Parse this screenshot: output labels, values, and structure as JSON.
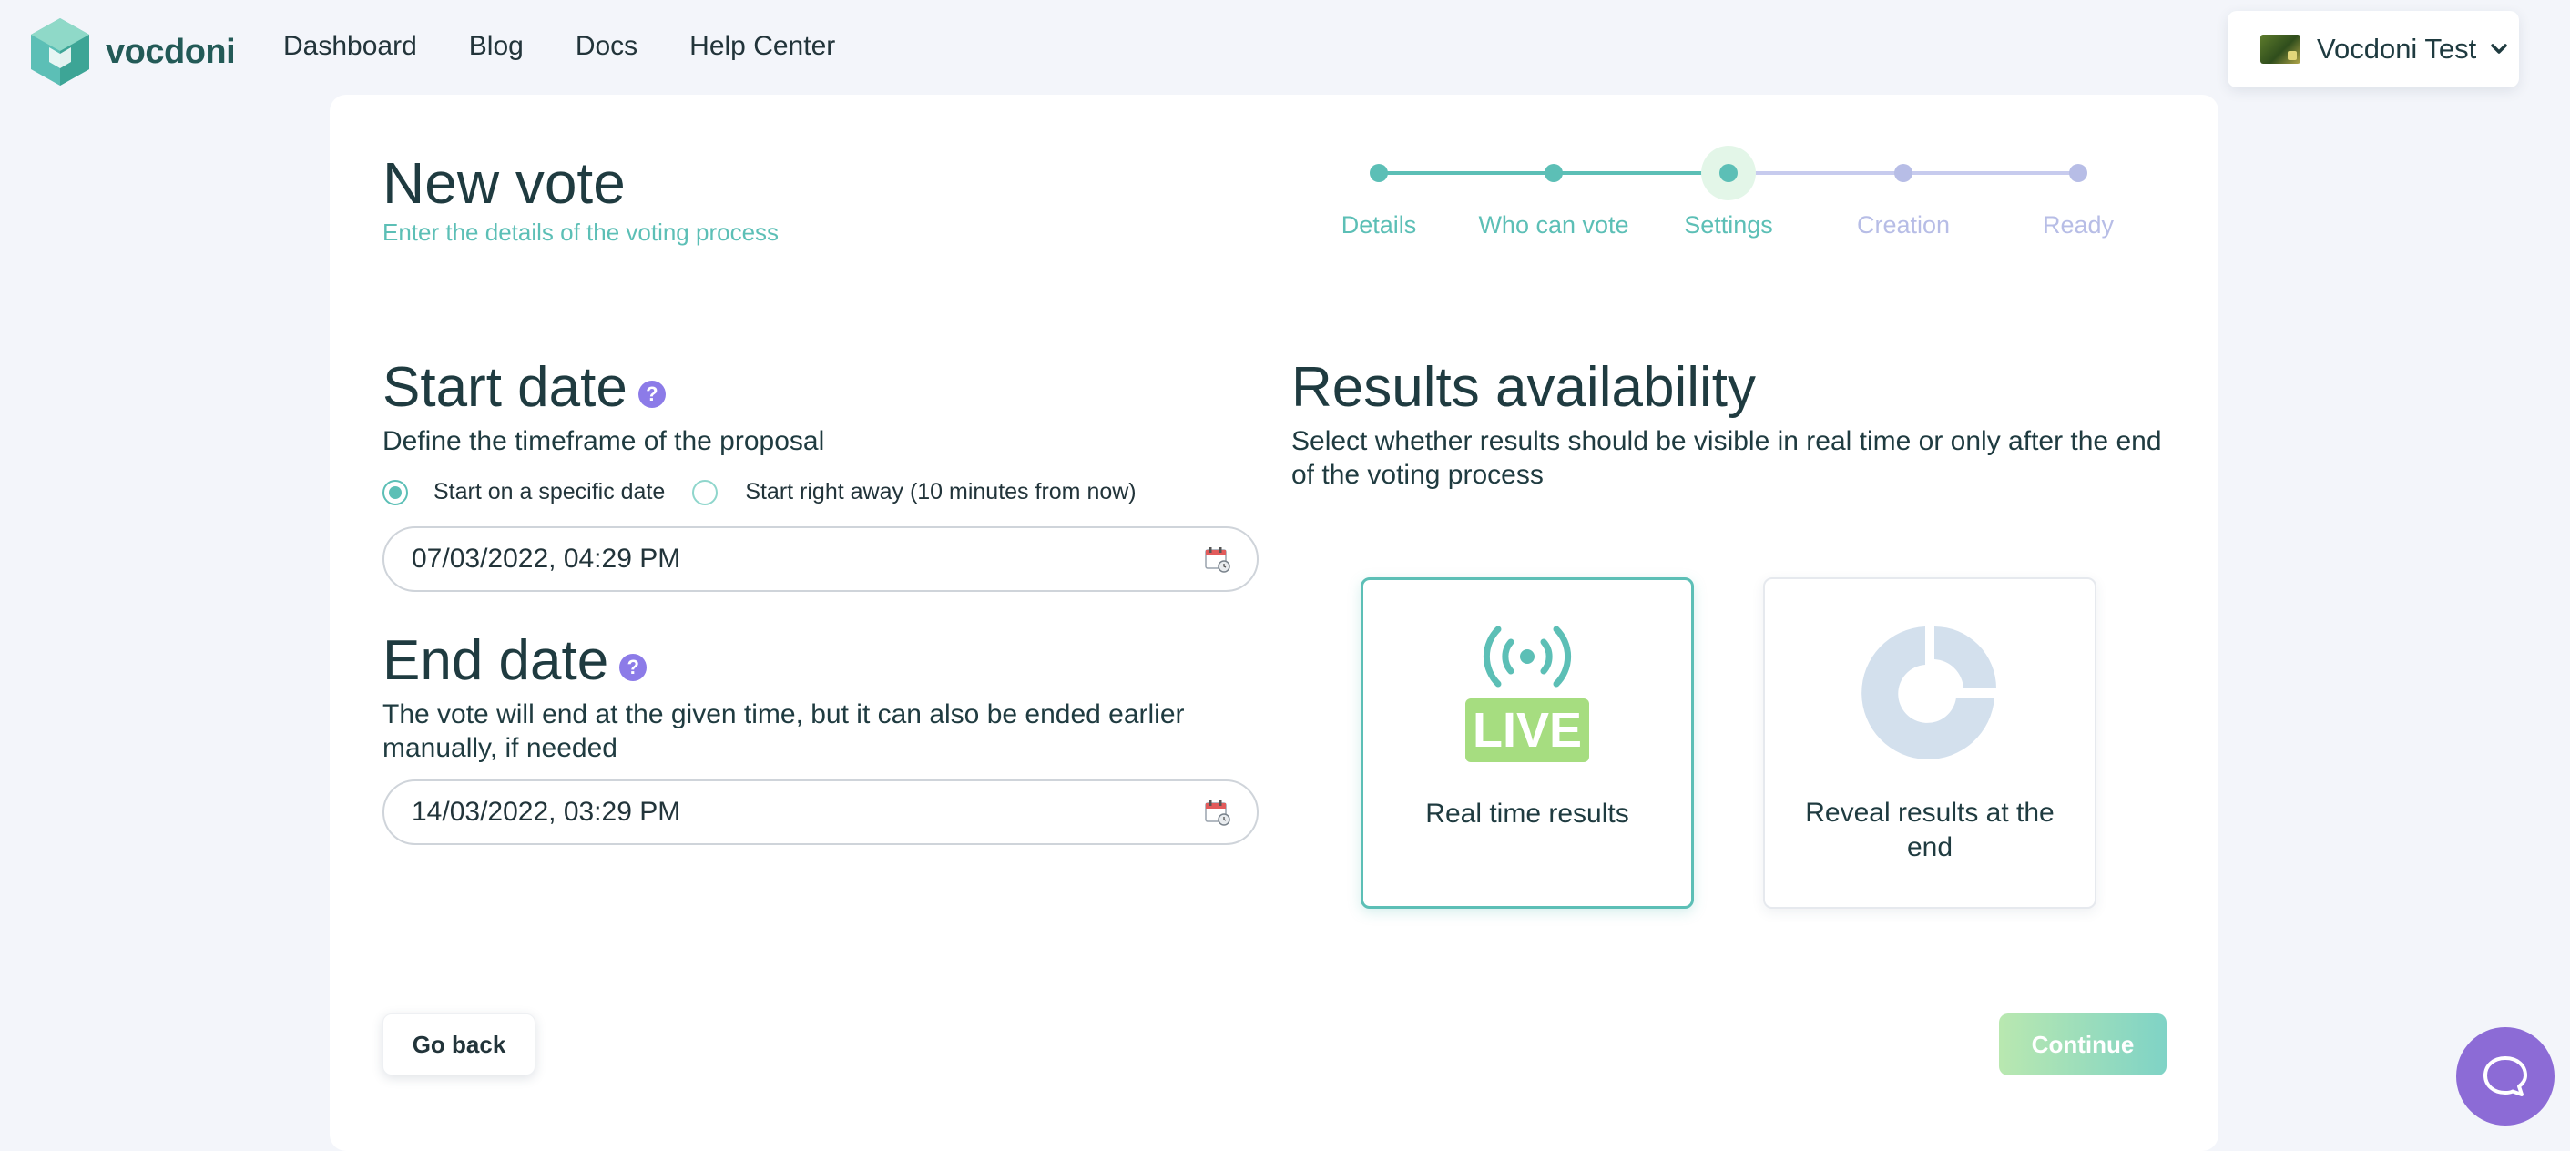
{
  "header": {
    "logo_text": "vocdoni",
    "nav": [
      "Dashboard",
      "Blog",
      "Docs",
      "Help Center"
    ],
    "account_name": "Vocdoni Test"
  },
  "page": {
    "title": "New vote",
    "subtitle": "Enter the details of the voting process"
  },
  "stepper": {
    "steps": [
      {
        "label": "Details",
        "state": "done"
      },
      {
        "label": "Who can vote",
        "state": "done"
      },
      {
        "label": "Settings",
        "state": "current"
      },
      {
        "label": "Creation",
        "state": "pending"
      },
      {
        "label": "Ready",
        "state": "pending"
      }
    ]
  },
  "start": {
    "title": "Start date",
    "help": "?",
    "description": "Define the timeframe of the proposal",
    "radio_specific": "Start on a specific date",
    "radio_now": "Start right away (10 minutes from now)",
    "value": "07/03/2022, 04:29 PM"
  },
  "end": {
    "title": "End date",
    "help": "?",
    "description": "The vote will end at the given time, but it can also be ended earlier manually, if needed",
    "value": "14/03/2022, 03:29 PM"
  },
  "results": {
    "title": "Results availability",
    "description": "Select whether results should be visible in real time or only after the end of the voting process",
    "live_badge": "LIVE",
    "option_realtime": "Real time results",
    "option_end": "Reveal results at the end"
  },
  "footer": {
    "back": "Go back",
    "continue": "Continue"
  },
  "colors": {
    "accent": "#5cbfb6",
    "pending": "#b7bde6",
    "help": "#8c7be8",
    "chat": "#8c6bd6"
  }
}
